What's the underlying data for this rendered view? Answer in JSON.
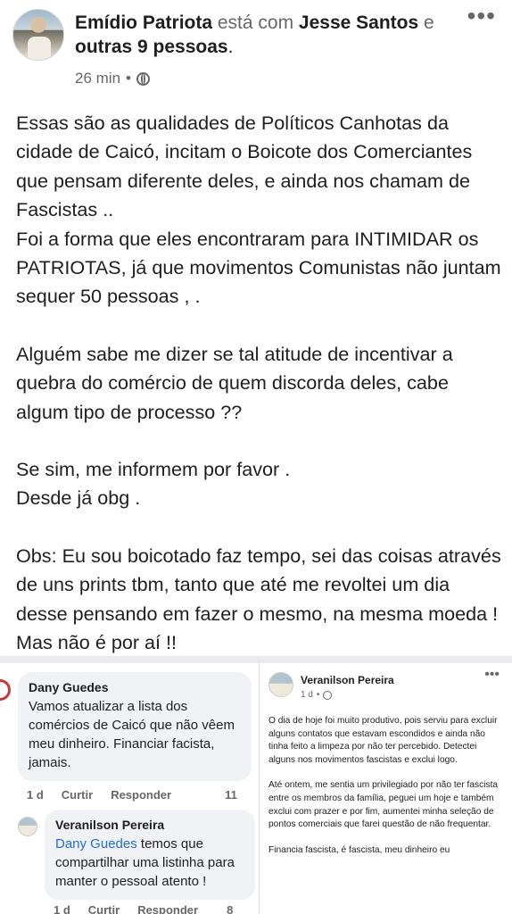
{
  "post": {
    "author": "Emídio Patriota",
    "with_text": "está com",
    "tagged": "Jesse Santos",
    "and_text": "e",
    "others": "outras 9 pessoas",
    "period": ".",
    "time": "26 min",
    "dot": "•",
    "more": "•••",
    "paragraphs": [
      "Essas são as qualidades de Políticos Canhotas da cidade de Caicó, incitam o Boicote dos Comerciantes que pensam diferente deles, e ainda nos chamam de Fascistas ..\nFoi a forma que eles encontraram para INTIMIDAR os PATRIOTAS, já que movimentos Comunistas não juntam sequer 50 pessoas , .",
      "Alguém sabe me dizer se tal atitude de incentivar a quebra do comércio de quem discorda deles, cabe algum tipo de processo ??",
      "Se sim, me informem por favor .\nDesde já obg .",
      "Obs: Eu sou boicotado faz tempo, sei das coisas através de uns prints tbm, tanto que até me revoltei um dia desse pensando em fazer o mesmo, na mesma moeda ! Mas não é por aí !!"
    ]
  },
  "comment": {
    "name": "Dany Guedes",
    "text": "Vamos atualizar a lista dos comércios de Caicó que não vêem meu dinheiro. Financiar facista, jamais.",
    "time": "1 d",
    "like": "Curtir",
    "reply": "Responder",
    "count": "11"
  },
  "reply": {
    "name": "Veranilson Pereira",
    "mention": "Dany Guedes",
    "text": " temos que compartilhar uma listinha para manter o pessoal atento !",
    "time": "1 d",
    "like": "Curtir",
    "reply": "Responder",
    "count": "8"
  },
  "shared_post": {
    "name": "Veranilson Pereira",
    "time": "1 d",
    "dot": "•",
    "more": "•••",
    "paragraphs": [
      "O dia de hoje foi muito produtivo, pois serviu para excluir alguns contatos que estavam escondidos e ainda não tinha feito a limpeza por não ter percebido. Detectei alguns nos movimentos fascistas e exclui logo.",
      "Até ontem, me sentia um privilegiado por não ter fascista entre os membros da família, peguei um hoje e também exclui com prazer e por fim, aumentei minha seleção de pontos comerciais que farei questão de não frequentar.",
      "Financia fascista, é fascista, meu dinheiro eu"
    ]
  },
  "colors": {
    "text": "#1c1e21",
    "muted": "#65676b",
    "mention": "#216fdb",
    "bubble": "#f0f2f5"
  }
}
